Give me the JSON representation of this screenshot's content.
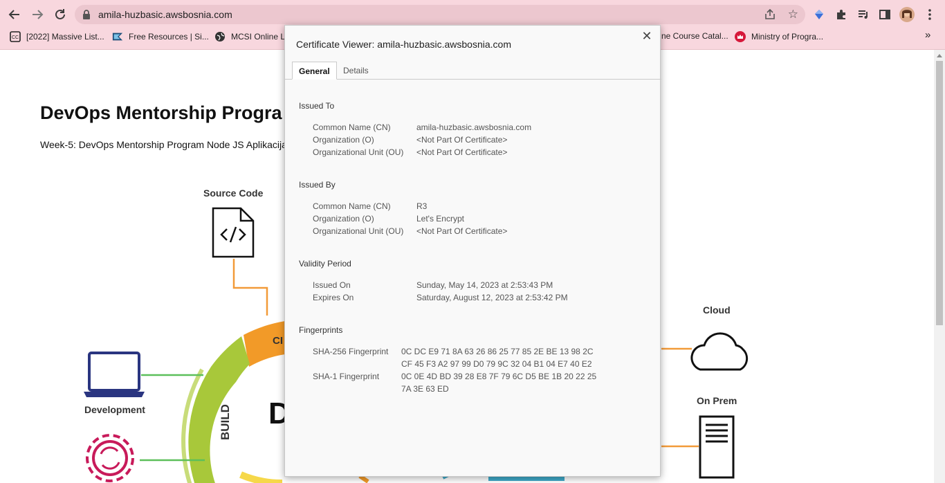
{
  "browser": {
    "url": "amila-huzbasic.awsbosnia.com",
    "bookmarks": [
      {
        "label": "[2022] Massive List..."
      },
      {
        "label": "Free Resources | Si..."
      },
      {
        "label": "MCSI Online Le"
      },
      {
        "label": "ne Course Catal..."
      },
      {
        "label": "Ministry of Progra..."
      }
    ],
    "more_bookmarks": "»"
  },
  "page": {
    "title": "DevOps Mentorship Progra",
    "subtitle": "Week-5: DevOps Mentorship Program Node JS Aplikacija",
    "diagram": {
      "source_code": "Source Code",
      "development": "Development",
      "cloud": "Cloud",
      "on_prem": "On Prem",
      "build": "BUILD",
      "ci_fragment": "CI",
      "devops_fragment": "D"
    }
  },
  "dialog": {
    "title": "Certificate Viewer: amila-huzbasic.awsbosnia.com",
    "tabs": [
      "General",
      "Details"
    ],
    "issued_to": {
      "heading": "Issued To",
      "rows": [
        {
          "label": "Common Name (CN)",
          "value": "amila-huzbasic.awsbosnia.com"
        },
        {
          "label": "Organization (O)",
          "value": "<Not Part Of Certificate>"
        },
        {
          "label": "Organizational Unit (OU)",
          "value": "<Not Part Of Certificate>"
        }
      ]
    },
    "issued_by": {
      "heading": "Issued By",
      "rows": [
        {
          "label": "Common Name (CN)",
          "value": "R3"
        },
        {
          "label": "Organization (O)",
          "value": "Let's Encrypt"
        },
        {
          "label": "Organizational Unit (OU)",
          "value": "<Not Part Of Certificate>"
        }
      ]
    },
    "validity": {
      "heading": "Validity Period",
      "rows": [
        {
          "label": "Issued On",
          "value": "Sunday, May 14, 2023 at 2:53:43 PM"
        },
        {
          "label": "Expires On",
          "value": "Saturday, August 12, 2023 at 2:53:42 PM"
        }
      ]
    },
    "fingerprints": {
      "heading": "Fingerprints",
      "sha256_label": "SHA-256 Fingerprint",
      "sha256_line1": "0C DC E9 71 8A 63 26 86 25 77 85 2E BE 13 98 2C",
      "sha256_line2": "CF 45 F3 A2 97 99 D0 79 9C 32 04 B1 04 E7 40 E2",
      "sha1_label": "SHA-1 Fingerprint",
      "sha1_line1": "0C 0E 4D BD 39 28 E8 7F 79 6C D5 BE 1B 20 22 25",
      "sha1_line2": "7A 3E 63 ED"
    }
  }
}
